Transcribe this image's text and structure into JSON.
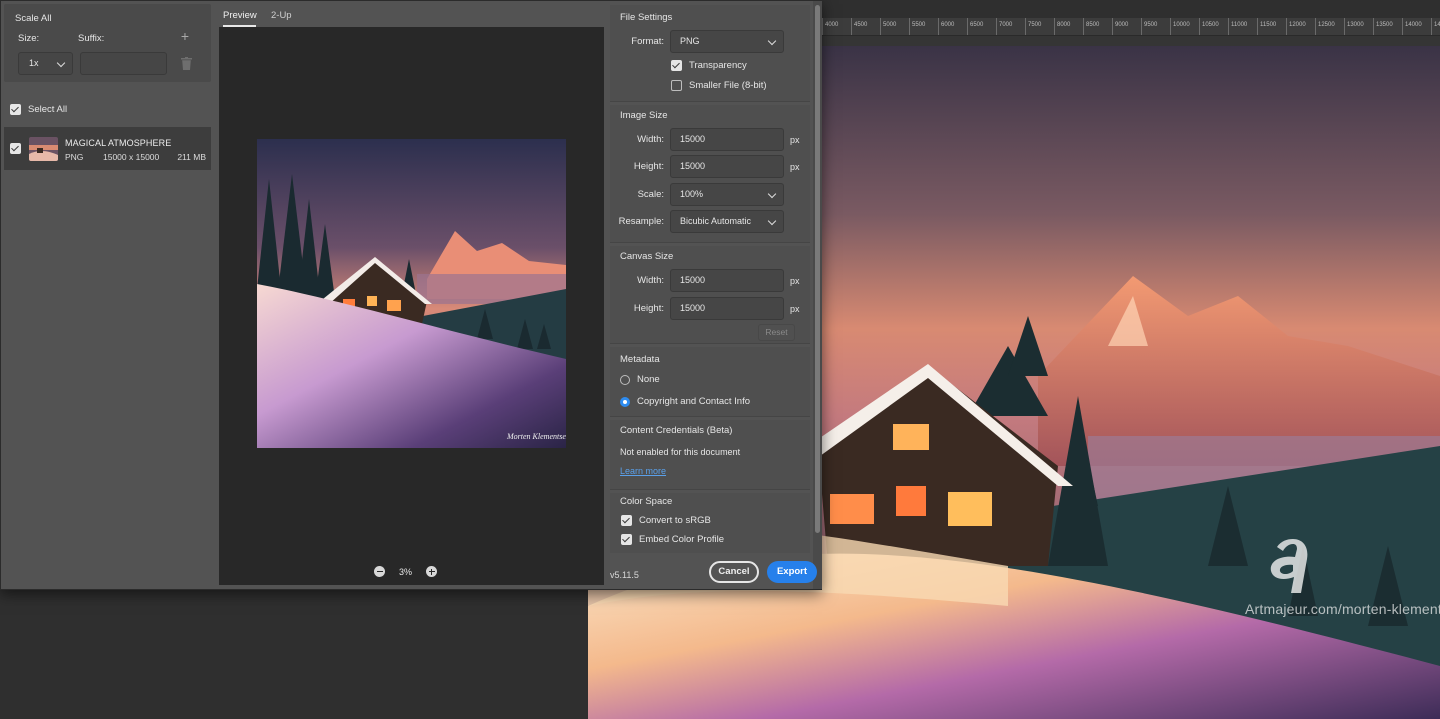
{
  "ruler": {
    "ticks": [
      "4000",
      "4500",
      "5000",
      "5500",
      "6000",
      "6500",
      "7000",
      "7500",
      "8000",
      "8500",
      "9000",
      "9500",
      "10000",
      "10500",
      "11000",
      "11500",
      "12000",
      "12500",
      "13000",
      "13500",
      "14000",
      "14500"
    ]
  },
  "watermark": {
    "text": "Artmajeur.com/morten-klementsen"
  },
  "left": {
    "scale_title": "Scale All",
    "size_label": "Size:",
    "suffix_label": "Suffix:",
    "size_value": "1x",
    "suffix_value": "",
    "select_all_label": "Select All",
    "asset": {
      "name": "MAGICAL ATMOSPHERE",
      "format": "PNG",
      "dimensions": "15000 x 15000",
      "filesize": "211 MB"
    }
  },
  "preview": {
    "tabs": [
      "Preview",
      "2-Up"
    ],
    "active_tab": "Preview",
    "zoom": "3%",
    "signature": "Morten Klementsen"
  },
  "settings": {
    "file_settings": {
      "title": "File Settings",
      "format_label": "Format:",
      "format_value": "PNG",
      "transparency_label": "Transparency",
      "transparency_checked": true,
      "smaller_file_label": "Smaller File (8-bit)",
      "smaller_file_checked": false
    },
    "image_size": {
      "title": "Image Size",
      "width_label": "Width:",
      "width_value": "15000",
      "height_label": "Height:",
      "height_value": "15000",
      "unit": "px",
      "scale_label": "Scale:",
      "scale_value": "100%",
      "resample_label": "Resample:",
      "resample_value": "Bicubic Automatic"
    },
    "canvas_size": {
      "title": "Canvas Size",
      "width_label": "Width:",
      "width_value": "15000",
      "height_label": "Height:",
      "height_value": "15000",
      "unit": "px",
      "reset_label": "Reset"
    },
    "metadata": {
      "title": "Metadata",
      "options": [
        "None",
        "Copyright and Contact Info"
      ],
      "selected": "Copyright and Contact Info"
    },
    "content_credentials": {
      "title": "Content Credentials (Beta)",
      "status": "Not enabled for this document",
      "link": "Learn more"
    },
    "color_space": {
      "title": "Color Space",
      "convert_label": "Convert to sRGB",
      "convert_checked": true,
      "embed_label": "Embed Color Profile",
      "embed_checked": true
    }
  },
  "footer": {
    "version": "v5.11.5",
    "cancel_label": "Cancel",
    "export_label": "Export"
  },
  "colors": {
    "accent": "#2680eb",
    "panel": "#535353",
    "canvas": "#282828"
  }
}
